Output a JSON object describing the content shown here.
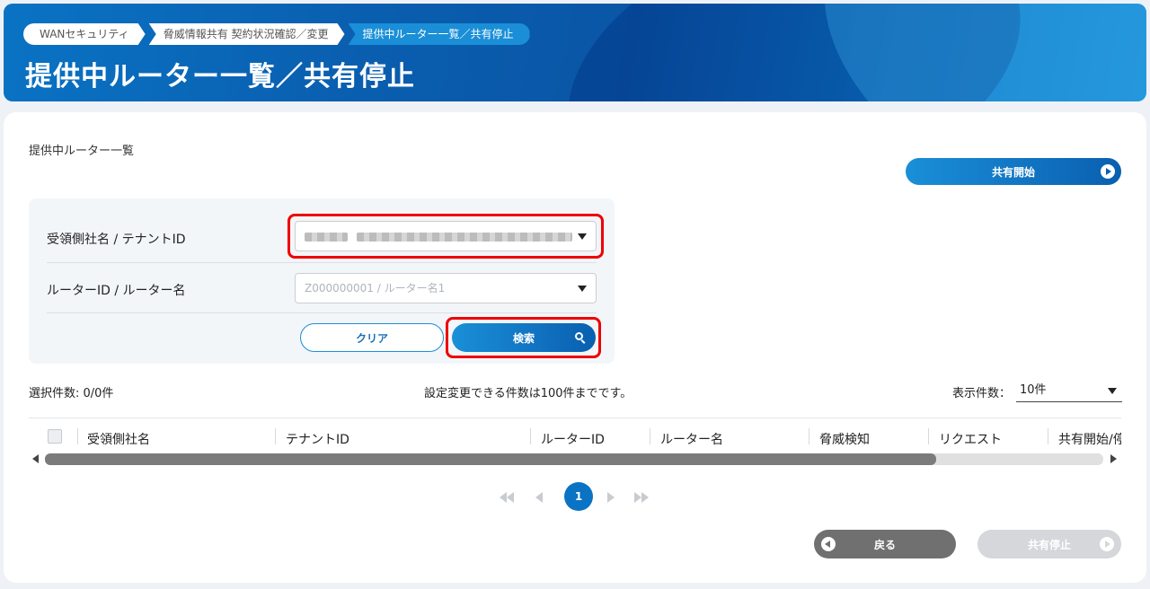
{
  "breadcrumb": [
    "WANセキュリティ",
    "脅威情報共有 契約状況確認／変更",
    "提供中ルーター一覧／共有停止"
  ],
  "page_title": "提供中ルーター一覧／共有停止",
  "section_title": "提供中ルーター一覧",
  "share_start_label": "共有開始",
  "filters": {
    "recipient_label": "受領側社名 / テナントID",
    "router_label": "ルーターID / ルーター名",
    "router_placeholder": "Z000000001 / ルーター名1"
  },
  "clear_label": "クリア",
  "search_label": "検索",
  "selected_count": "選択件数: 0/0件",
  "notice": "設定変更できる件数は100件までです。",
  "per_page_label": "表示件数：",
  "per_page_value": "10件",
  "columns": [
    "受領側社名",
    "テナントID",
    "ルーターID",
    "ルーター名",
    "脅威検知",
    "リクエスト",
    "共有開始/停"
  ],
  "pagination": {
    "current": "1"
  },
  "back_label": "戻る",
  "share_stop_label": "共有停止",
  "colors": {
    "primary": "#0a73c4",
    "highlight": "#e00000",
    "disabled": "#d5d7da"
  }
}
